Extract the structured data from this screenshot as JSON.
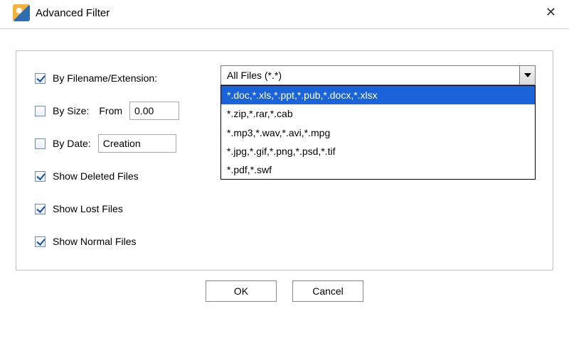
{
  "window": {
    "title": "Advanced Filter"
  },
  "filters": {
    "by_filename": {
      "checked": true,
      "label": "By Filename/Extension:",
      "selected": "All Files (*.*)",
      "options": [
        "*.doc,*.xls,*.ppt,*.pub,*.docx,*.xlsx",
        "*.zip,*.rar,*.cab",
        "*.mp3,*.wav,*.avi,*.mpg",
        "*.jpg,*.gif,*.png,*.psd,*.tif",
        "*.pdf,*.swf"
      ],
      "highlighted_index": 0
    },
    "by_size": {
      "checked": false,
      "label": "By Size:",
      "from_label": "From",
      "from_value": "0.00"
    },
    "by_date": {
      "checked": false,
      "label": "By Date:",
      "type_value": "Creation"
    },
    "show_deleted": {
      "checked": true,
      "label": "Show Deleted Files"
    },
    "show_lost": {
      "checked": true,
      "label": "Show Lost Files"
    },
    "show_normal": {
      "checked": true,
      "label": "Show Normal Files"
    }
  },
  "buttons": {
    "ok": "OK",
    "cancel": "Cancel"
  }
}
